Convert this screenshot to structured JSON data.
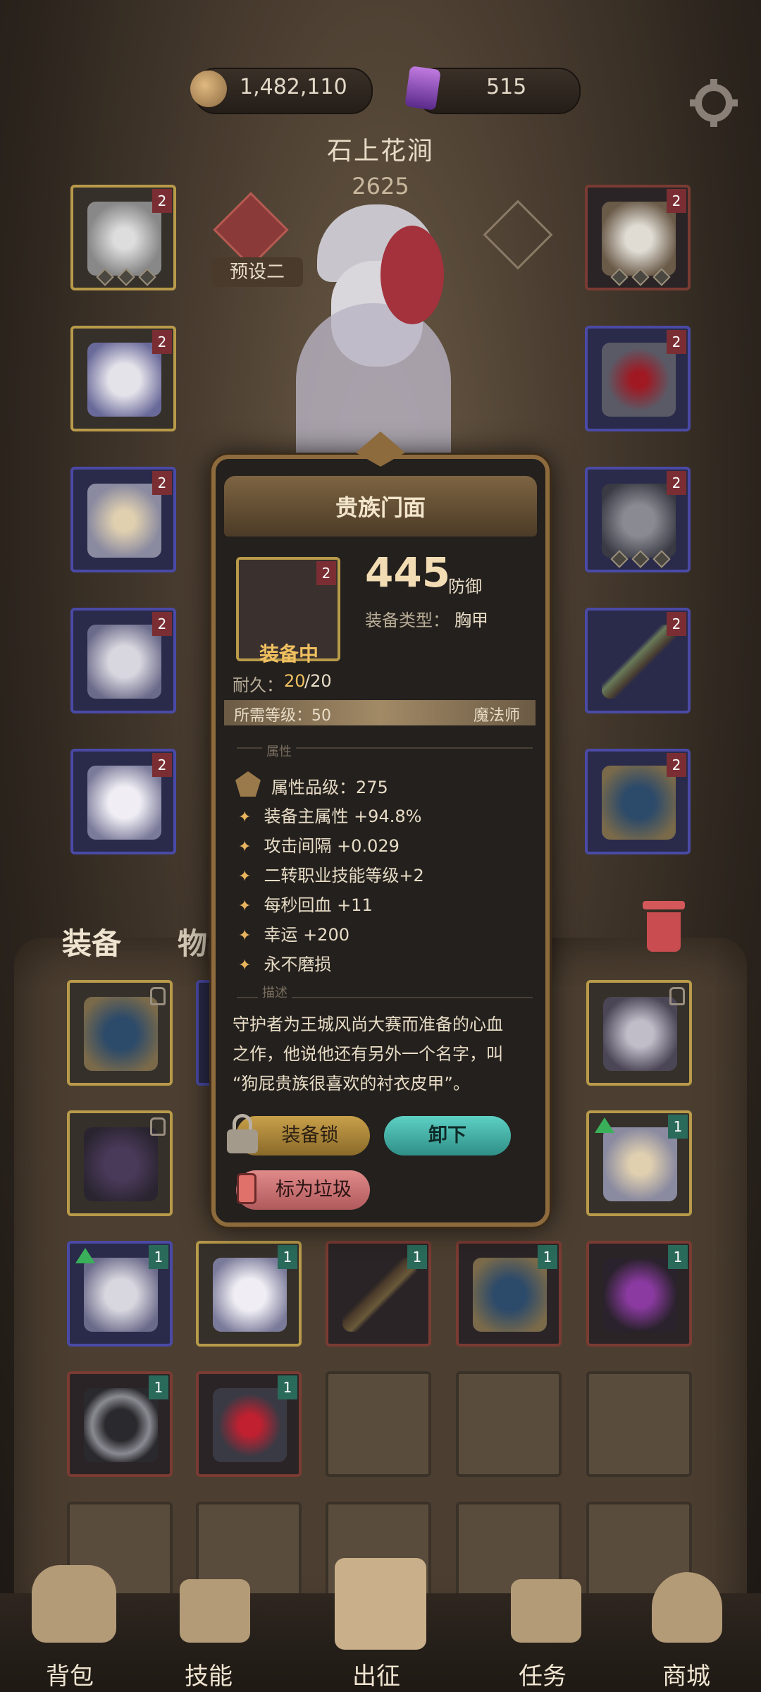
{
  "resources": {
    "gold": "1,482,110",
    "gems": "515"
  },
  "header": {
    "location": "石上花涧",
    "power": "2625",
    "preset_label": "预设二"
  },
  "equip_slots": {
    "left_tiers": [
      "2",
      "2",
      "2",
      "2",
      "2"
    ],
    "right_tiers": [
      "2",
      "2",
      "2",
      "2",
      "2"
    ]
  },
  "tooltip": {
    "name": "贵族门面",
    "tier": "2",
    "defense_value": "445",
    "defense_label": "防御",
    "type_label": "装备类型：",
    "type_value": "胸甲",
    "equipped_label": "装备中",
    "durability_label": "耐久：",
    "durability_current": "20",
    "durability_max": "/20",
    "level_req": "所需等级：50",
    "class": "魔法师",
    "section_attributes": "属性",
    "quality": "属性品级：275",
    "attributes": [
      "装备主属性 +94.8%",
      "攻击间隔 +0.029",
      "二转职业技能等级+2",
      "每秒回血 +11",
      "幸运 +200",
      "永不磨损"
    ],
    "section_description": "描述",
    "description_line1": "守护者为王城风尚大赛而准备的心血",
    "description_line2": "之作，他说他还有另外一个名字，叫",
    "description_line3": "“狗屁贵族很喜欢的衬衣皮甲”。",
    "btn_lock": "装备锁",
    "btn_unequip": "卸下",
    "btn_trash": "标为垃圾"
  },
  "tabs": {
    "equipment": "装备",
    "items": "物品"
  },
  "inventory": {
    "tiers": [
      "1",
      "1",
      "1",
      "1",
      "1",
      "1",
      "1",
      "1",
      "1",
      "1",
      "1"
    ]
  },
  "nav": {
    "items": [
      "背包",
      "技能",
      "出征",
      "任务",
      "商城"
    ]
  },
  "colors": {
    "gold_accent": "#e9b45e",
    "durability": "#f0c060",
    "unequip_btn": "#4fb7ae",
    "trash_btn": "#d4787a",
    "lock_btn": "#b8923c"
  }
}
